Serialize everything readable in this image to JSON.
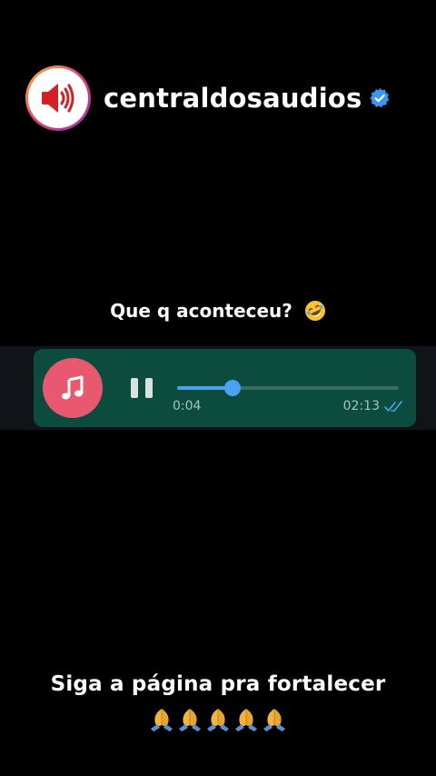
{
  "header": {
    "username": "centraldosaudios",
    "avatar_icon": "speaker-volume-icon",
    "verified_icon": "verified-badge-icon"
  },
  "caption": {
    "text": "Que q aconteceu?",
    "emoji_icon": "rolling-on-floor-laughing-emoji"
  },
  "player": {
    "music_icon": "music-note-icon",
    "state_icon": "pause-icon",
    "elapsed": "0:04",
    "duration": "02:13",
    "progress": 0.25,
    "status_icon": "double-check-read-icon",
    "colors": {
      "bubble": "#0b4c3f",
      "accent": "#4aa3f0",
      "music_button": "#e8586f"
    }
  },
  "footer": {
    "text": "Siga a página pra fortalecer",
    "emoji_icon": "folded-hands-emoji",
    "emoji_count": 5
  }
}
